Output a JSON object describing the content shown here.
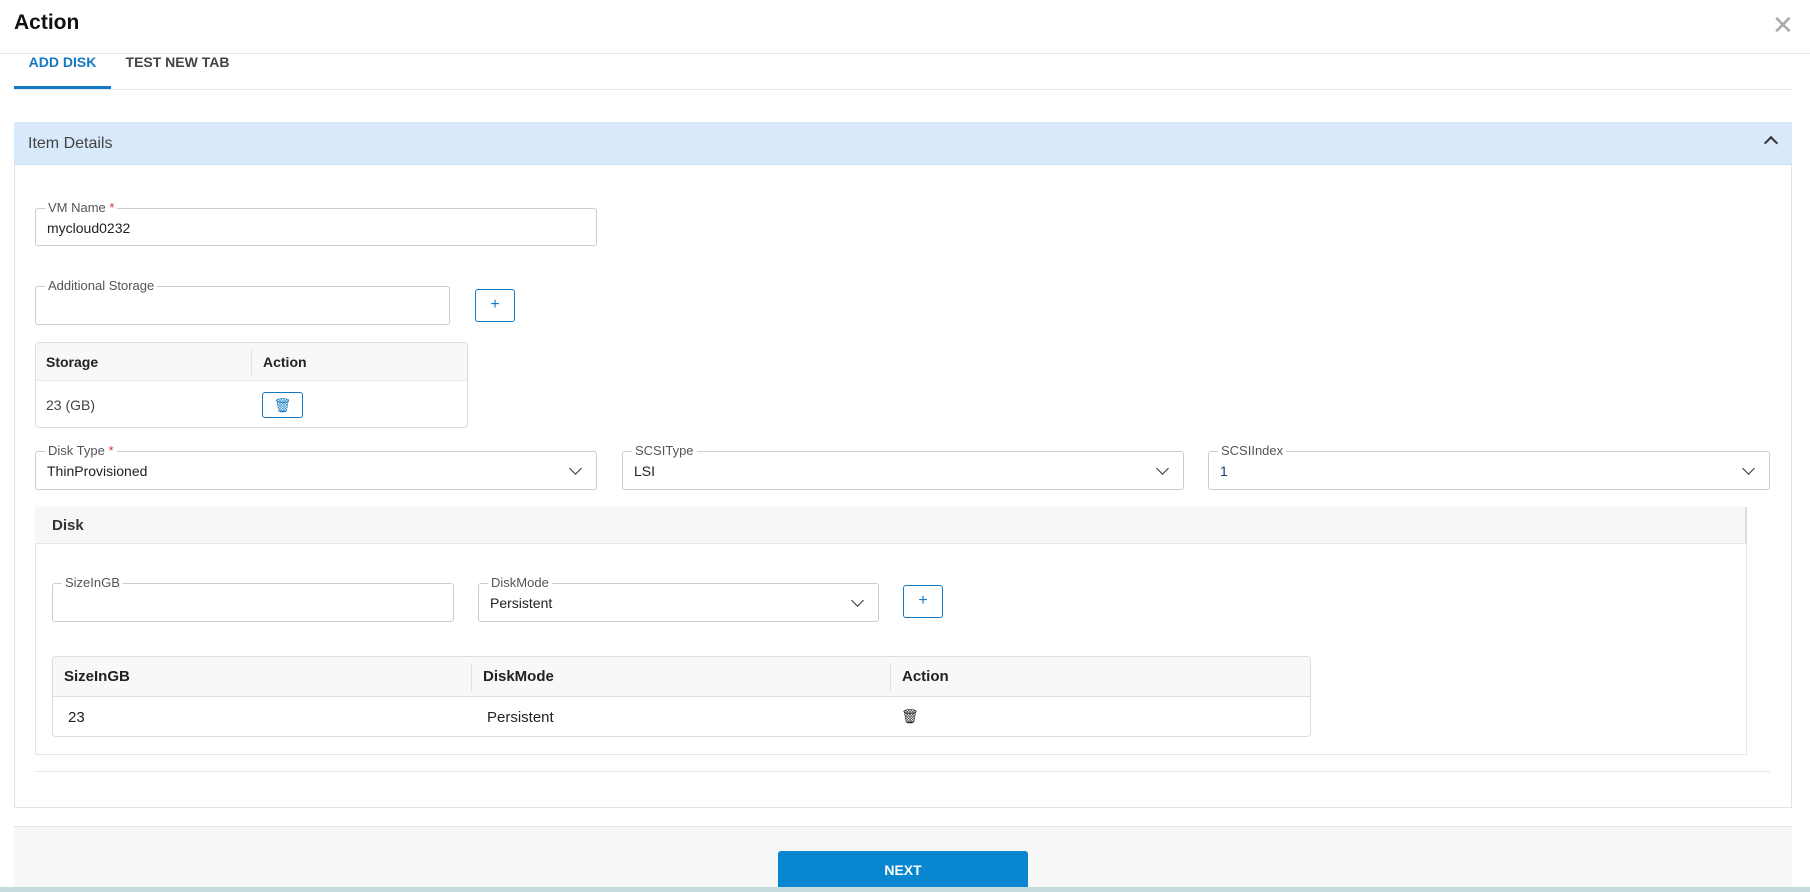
{
  "dialog": {
    "title": "Action",
    "close_icon": "close-icon"
  },
  "tabs": [
    {
      "label": "ADD DISK",
      "active": true
    },
    {
      "label": "TEST NEW TAB",
      "active": false
    }
  ],
  "panel": {
    "title": "Item Details",
    "collapse_icon": "chevron-up-icon"
  },
  "vm_name": {
    "label": "VM Name",
    "required": "*",
    "value": "mycloud0232"
  },
  "additional_storage": {
    "label": "Additional Storage",
    "value": "",
    "add_label": "+"
  },
  "storage_table": {
    "headers": [
      "Storage",
      "Action"
    ],
    "rows": [
      {
        "storage": "23 (GB)",
        "action_icon": "trash-icon"
      }
    ]
  },
  "disk_type": {
    "label": "Disk Type",
    "required": "*",
    "value": "ThinProvisioned"
  },
  "scsi_type": {
    "label": "SCSIType",
    "value": "LSI"
  },
  "scsi_index": {
    "label": "SCSIIndex",
    "value": "1"
  },
  "disk": {
    "title": "Disk",
    "size_label": "SizeInGB",
    "size_value": "",
    "mode_label": "DiskMode",
    "mode_value": "Persistent",
    "add_label": "+",
    "table": {
      "headers": [
        "SizeInGB",
        "DiskMode",
        "Action"
      ],
      "rows": [
        {
          "size": "23",
          "mode": "Persistent",
          "action_icon": "trash-icon"
        }
      ]
    }
  },
  "footer": {
    "next_label": "NEXT"
  },
  "colors": {
    "accent": "#1479c4",
    "panel_header": "#d7e9fa",
    "next_button": "#0886d0"
  }
}
